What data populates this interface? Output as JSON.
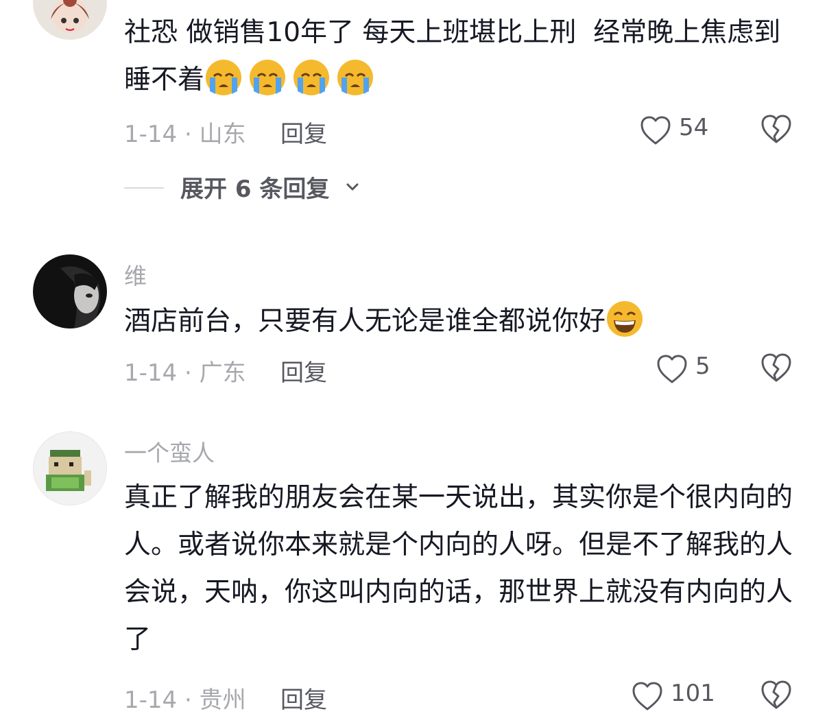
{
  "comments": [
    {
      "username": "",
      "text": "社恐 做销售10年了 每天上班堪比上刑  经常晚上焦虑到睡不着",
      "emojis": [
        "loudly-crying-face",
        "loudly-crying-face",
        "loudly-crying-face",
        "loudly-crying-face"
      ],
      "date_location": "1-14 · 山东",
      "reply_label": "回复",
      "likes": "54",
      "expand_label": "展开 6 条回复"
    },
    {
      "username": "维",
      "text": "酒店前台，只要有人无论是谁全都说你好",
      "emojis": [
        "grinning-squinting-face"
      ],
      "date_location": "1-14 · 广东",
      "reply_label": "回复",
      "likes": "5"
    },
    {
      "username": "一个蛮人",
      "text": "真正了解我的朋友会在某一天说出，其实你是个很内向的人。或者说你本来就是个内向的人呀。但是不了解我的人会说，天呐，你这叫内向的话，那世界上就没有内向的人了",
      "date_location": "1-14 · 贵州",
      "reply_label": "回复",
      "likes": "101"
    }
  ],
  "colors": {
    "primary_text": "#161823",
    "secondary_text": "#a7a8ad",
    "action_text": "#57585f",
    "icon_stroke": "#57585f",
    "emoji_face": "#f5b92e",
    "emoji_tear": "#4fa3f0"
  }
}
